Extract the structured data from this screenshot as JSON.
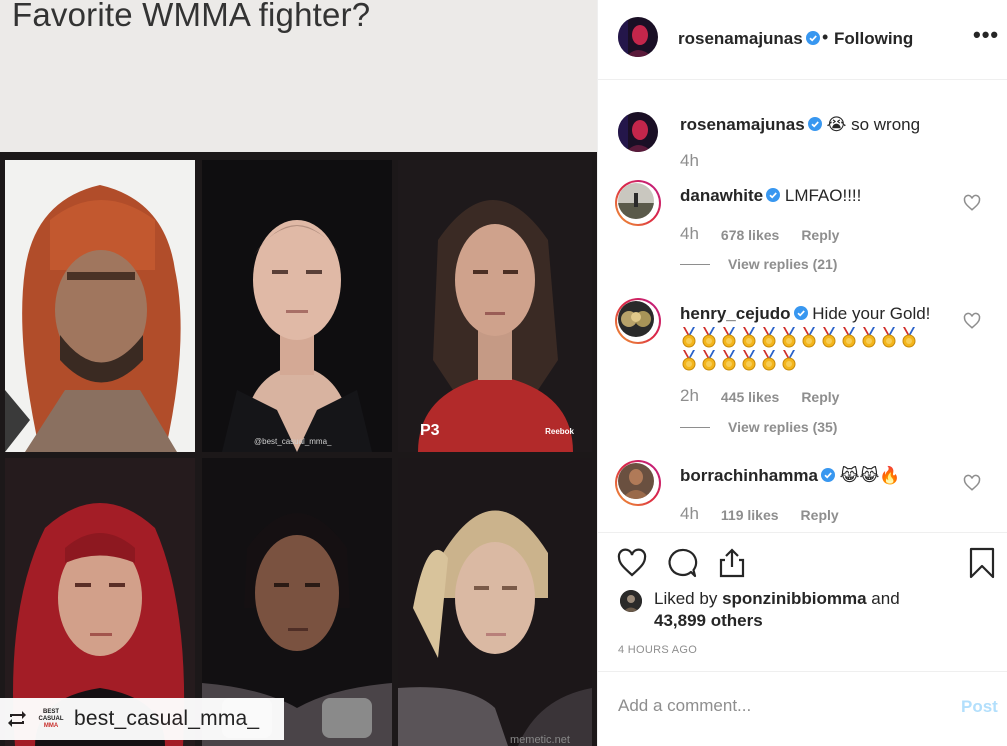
{
  "media": {
    "title": "Favorite WMMA fighter?",
    "watermark": "@best_casual_mma_",
    "p3_label": "P3",
    "reebok_label": "Reebok",
    "repost_user": "best_casual_mma_",
    "repost_logo": [
      "BEST",
      "CASUAL",
      "MMA"
    ],
    "footer_credit": "memetic.net"
  },
  "header": {
    "username": "rosenamajunas",
    "dot": "•",
    "follow_status": "Following",
    "more": "•••"
  },
  "comments": [
    {
      "user": "rosenamajunas",
      "verified": true,
      "emoji": "😭",
      "text": "so wrong",
      "time": "4h",
      "likes": "",
      "reply": "",
      "view_replies": ""
    },
    {
      "user": "danawhite",
      "verified": true,
      "text": "LMFAO!!!!",
      "time": "4h",
      "likes": "678 likes",
      "reply": "Reply",
      "view_replies": "View replies (21)"
    },
    {
      "user": "henry_cejudo",
      "verified": true,
      "text": "Hide your Gold!",
      "medal_count": 18,
      "time": "2h",
      "likes": "445 likes",
      "reply": "Reply",
      "view_replies": "View replies (35)"
    },
    {
      "user": "borrachinhamma",
      "verified": true,
      "text": "😹😹🔥",
      "time": "4h",
      "likes": "119 likes",
      "reply": "Reply",
      "view_replies": ""
    }
  ],
  "actions": {
    "liked_prefix": "Liked by",
    "liked_user": "sponzinibbiomma",
    "liked_and": "and",
    "liked_others": "43,899 others",
    "time_ago": "4 HOURS AGO"
  },
  "add_comment": {
    "placeholder": "Add a comment...",
    "post_label": "Post"
  },
  "colors": {
    "verified": "#3897f0",
    "post_disabled": "#b2dffc",
    "muted": "#8e8e8e"
  }
}
